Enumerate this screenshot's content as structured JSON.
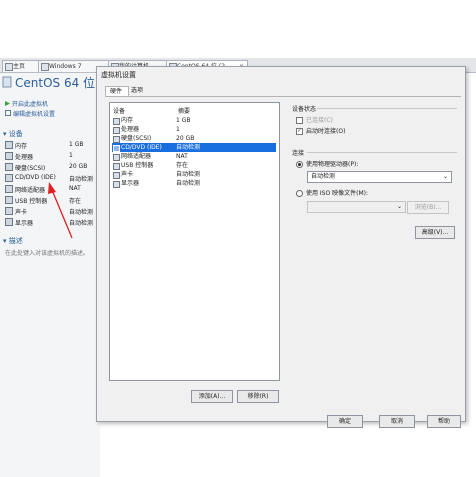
{
  "tabs": [
    {
      "label": "主页"
    },
    {
      "label": "Windows 7"
    },
    {
      "label": "我的计算机"
    },
    {
      "label": "CentOS 64 位 (2"
    }
  ],
  "left": {
    "vm_title": "CentOS 64 位 (2",
    "actions": [
      "开启此虚拟机",
      "编辑虚拟机设置"
    ],
    "devices_header": "设备",
    "devices": [
      {
        "name": "内存",
        "value": "1 GB"
      },
      {
        "name": "处理器",
        "value": "1"
      },
      {
        "name": "硬盘(SCSI)",
        "value": "20 GB"
      },
      {
        "name": "CD/DVD (IDE)",
        "value": "自动检测"
      },
      {
        "name": "网络适配器",
        "value": "NAT"
      },
      {
        "name": "USB 控制器",
        "value": "存在"
      },
      {
        "name": "声卡",
        "value": "自动检测"
      },
      {
        "name": "显示器",
        "value": "自动检测"
      }
    ],
    "description_header": "描述",
    "description_text": "在此处键入对该虚拟机的描述。"
  },
  "dialog": {
    "title": "虚拟机设置",
    "tabs": [
      "硬件",
      "选项"
    ],
    "list_headers": {
      "device": "设备",
      "summary": "摘要"
    },
    "hardware": [
      {
        "name": "内存",
        "value": "1 GB",
        "icon": "memory-icon"
      },
      {
        "name": "处理器",
        "value": "1",
        "icon": "cpu-icon"
      },
      {
        "name": "硬盘(SCSI)",
        "value": "20 GB",
        "icon": "disk-icon"
      },
      {
        "name": "CD/DVD (IDE)",
        "value": "自动检测",
        "icon": "cdrom-icon",
        "selected": true
      },
      {
        "name": "网络适配器",
        "value": "NAT",
        "icon": "network-icon"
      },
      {
        "name": "USB 控制器",
        "value": "存在",
        "icon": "usb-icon"
      },
      {
        "name": "声卡",
        "value": "自动检测",
        "icon": "sound-icon"
      },
      {
        "name": "显示器",
        "value": "自动检测",
        "icon": "display-icon"
      }
    ],
    "add_button": "添加(A)...",
    "remove_button": "移除(R)",
    "device_status": {
      "header": "设备状态",
      "connected": "已连接(C)",
      "connect_on_power": "启动时连接(O)",
      "connect_on_power_checked": true,
      "connected_checked": false
    },
    "connection": {
      "header": "连接",
      "physical_drive": "使用物理驱动器(P):",
      "physical_drive_selected": true,
      "drive_select": "自动检测",
      "iso": "使用 ISO 映像文件(M):",
      "browse": "浏览(B)..."
    },
    "advanced_button": "高级(V)...",
    "ok_button": "确定",
    "cancel_button": "取消",
    "help_button": "帮助"
  },
  "colors": {
    "selection": "#1a6fe0",
    "link": "#2b5d9a",
    "arrow": "#e02020"
  }
}
